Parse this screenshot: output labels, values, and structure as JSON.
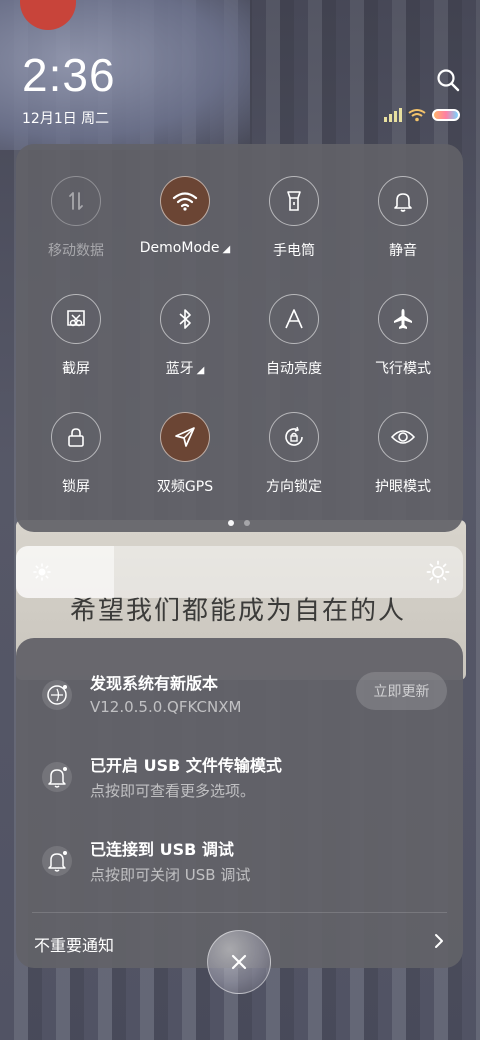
{
  "status": {
    "time": "2:36",
    "date": "12月1日 周二"
  },
  "toggles": [
    {
      "label": "移动数据",
      "state": "off",
      "icon": "mobile-data-icon"
    },
    {
      "label": "DemoMode",
      "state": "on",
      "icon": "wifi-icon",
      "expandable": true
    },
    {
      "label": "手电筒",
      "state": "idle",
      "icon": "flashlight-icon"
    },
    {
      "label": "静音",
      "state": "idle",
      "icon": "bell-icon"
    },
    {
      "label": "截屏",
      "state": "idle",
      "icon": "screenshot-icon"
    },
    {
      "label": "蓝牙",
      "state": "idle",
      "icon": "bluetooth-icon",
      "expandable": true
    },
    {
      "label": "自动亮度",
      "state": "idle",
      "icon": "auto-brightness-icon"
    },
    {
      "label": "飞行模式",
      "state": "idle",
      "icon": "airplane-icon"
    },
    {
      "label": "锁屏",
      "state": "idle",
      "icon": "lock-icon"
    },
    {
      "label": "双频GPS",
      "state": "on",
      "icon": "gps-icon"
    },
    {
      "label": "方向锁定",
      "state": "idle",
      "icon": "rotation-lock-icon"
    },
    {
      "label": "护眼模式",
      "state": "idle",
      "icon": "eye-icon"
    }
  ],
  "pager": {
    "pages": 2,
    "active": 1
  },
  "brightness": {
    "level": 0.22
  },
  "notifications": [
    {
      "title": "发现系统有新版本",
      "subtitle": "V12.0.5.0.QFKCNXM",
      "action": "立即更新",
      "icon": "system-update-icon"
    },
    {
      "title": "已开启 USB 文件传输模式",
      "subtitle": "点按即可查看更多选项。",
      "icon": "notification-bell-icon"
    },
    {
      "title": "已连接到 USB 调试",
      "subtitle": "点按即可关闭 USB 调试",
      "icon": "notification-bell-icon"
    }
  ],
  "footer": {
    "unimportant_label": "不重要通知"
  },
  "wallpaper_text": "希望我们都能成为自在的人",
  "colors": {
    "active_toggle": "#6b4534",
    "panel": "#626268"
  }
}
